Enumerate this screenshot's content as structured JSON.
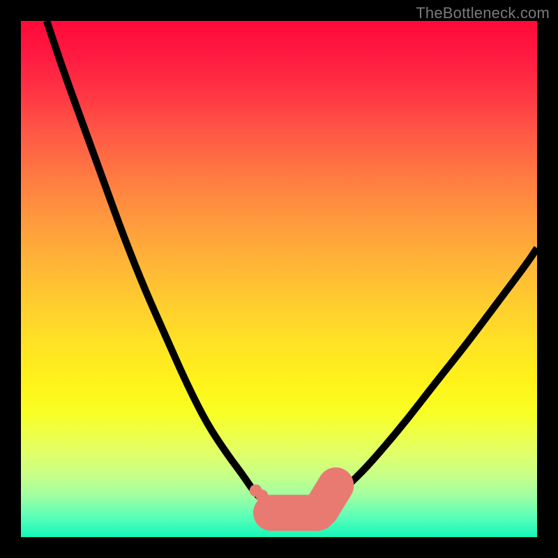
{
  "watermark": "TheBottleneck.com",
  "colors": {
    "background": "#000000",
    "curve": "#000000",
    "marker": "#e97a72"
  },
  "chart_data": {
    "type": "line",
    "title": "",
    "xlabel": "",
    "ylabel": "",
    "xlim": [
      0,
      100
    ],
    "ylim": [
      0,
      100
    ],
    "grid": false,
    "note": "Axes unlabeled — x/y expressed as percent of plot width/height with origin at top-left. Curve shows a steep V reaching minimum near x≈53.",
    "series": [
      {
        "name": "left-branch",
        "x": [
          5,
          8,
          12,
          16,
          20,
          24,
          28,
          32,
          36,
          40,
          43,
          45,
          47,
          49,
          51,
          53
        ],
        "y": [
          0,
          9,
          20,
          31,
          42,
          52,
          61,
          70,
          78,
          84,
          88,
          91,
          93,
          94.5,
          95.3,
          95.6
        ]
      },
      {
        "name": "right-branch",
        "x": [
          53,
          55,
          57,
          59,
          62,
          66,
          70,
          75,
          80,
          86,
          92,
          98,
          100
        ],
        "y": [
          95.6,
          95.3,
          94.6,
          93.4,
          91.2,
          87.5,
          83,
          77,
          70.5,
          63,
          55,
          47,
          44
        ]
      }
    ],
    "markers": {
      "name": "highlighted-region",
      "approx_x_range": [
        45,
        61
      ],
      "approx_y_range": [
        90,
        96
      ],
      "points": [
        {
          "x": 45.5,
          "y": 91.0
        },
        {
          "x": 46.7,
          "y": 92.0
        },
        {
          "x": 47.7,
          "y": 93.2
        },
        {
          "x": 58.5,
          "y": 94.3
        },
        {
          "x": 59.3,
          "y": 93.2
        },
        {
          "x": 60.0,
          "y": 92.0
        },
        {
          "x": 60.8,
          "y": 90.4
        }
      ],
      "bottom_bar_x": [
        48.5,
        57.5
      ],
      "bottom_bar_y": 95.3
    }
  }
}
